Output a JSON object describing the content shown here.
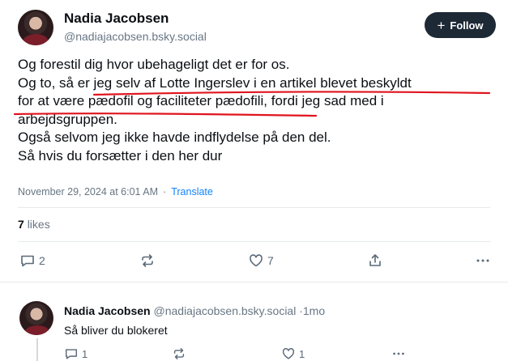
{
  "post": {
    "author_name": "Nadia Jacobsen",
    "author_handle": "@nadiajacobsen.bsky.social",
    "follow_label": "Follow",
    "lines": [
      "Og forestil dig hvor ubehageligt det er for os.",
      "Og to, så er jeg selv af Lotte Ingerslev i en artikel blevet beskyldt",
      "for at være pædofil og faciliteter pædofili, fordi jeg sad med i",
      "arbejdsgruppen.",
      "Også selvom jeg ikke havde indflydelse på den del.",
      "Så hvis du forsætter i den her dur"
    ],
    "timestamp": "November 29, 2024 at 6:01 AM",
    "meta_separator": "·",
    "translate_label": "Translate",
    "likes_count": "7",
    "likes_label": "likes",
    "reply_count": "2",
    "like_count": "7",
    "underline_color": "#e0141e"
  },
  "reply": {
    "author_name": "Nadia Jacobsen",
    "author_handle": "@nadiajacobsen.bsky.social",
    "time_sep": "·",
    "time": "1mo",
    "text": "Så bliver du blokeret",
    "reply_count": "1",
    "like_count": "1"
  },
  "icons": {
    "reply": "speech-bubble-icon",
    "repost": "repost-arrows-icon",
    "like": "heart-icon",
    "share": "share-icon",
    "more": "ellipsis-icon"
  }
}
